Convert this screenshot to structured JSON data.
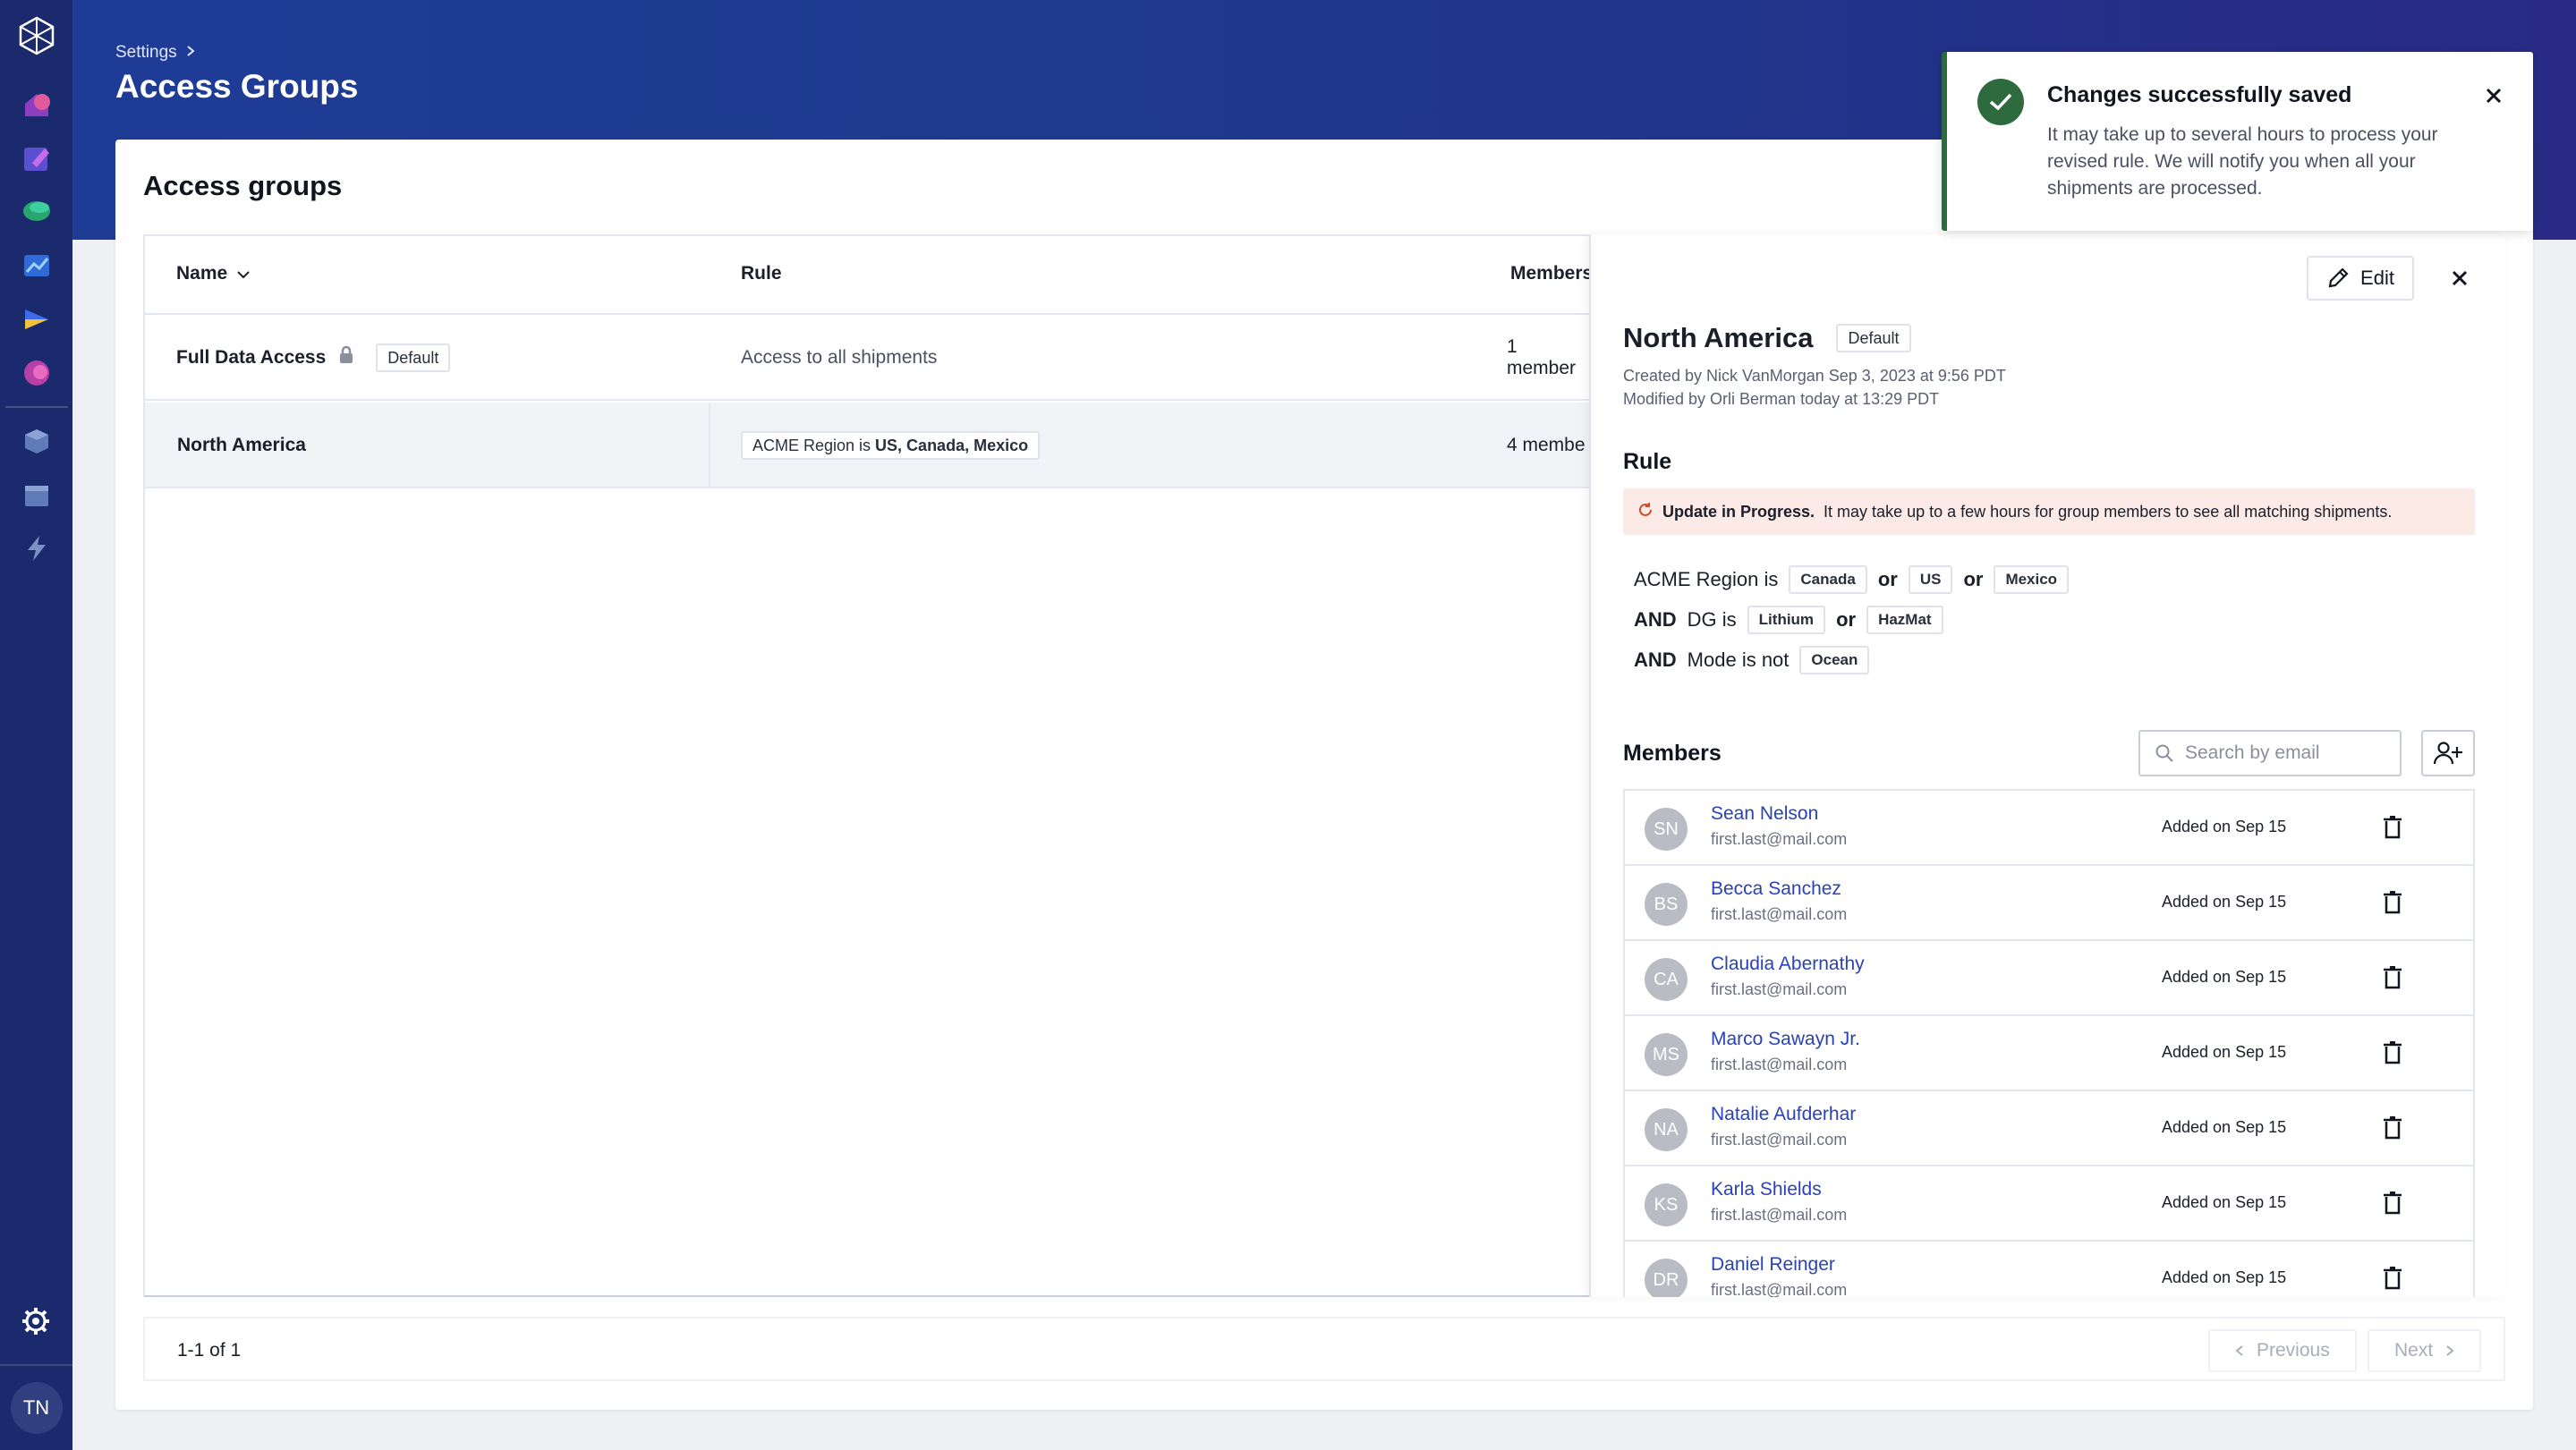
{
  "nav": {
    "user_initials": "TN"
  },
  "header": {
    "breadcrumb": "Settings",
    "title": "Access Groups"
  },
  "main": {
    "card_title": "Access groups",
    "columns": {
      "name": "Name",
      "rule": "Rule",
      "members": "Members"
    },
    "rows": [
      {
        "name": "Full Data Access",
        "badge": "Default",
        "rule": "Access to all shipments",
        "members": "1 member"
      },
      {
        "name": "North America",
        "rule_prefix": "ACME Region is",
        "rule_values": "US, Canada, Mexico",
        "members": "4 membe"
      }
    ],
    "pagination": {
      "range": "1-1 of 1",
      "previous": "Previous",
      "next": "Next"
    }
  },
  "panel": {
    "edit_label": "Edit",
    "title": "North America",
    "badge": "Default",
    "created": "Created by Nick VanMorgan Sep 3, 2023 at 9:56 PDT",
    "modified": "Modified by Orli Berman today at 13:29 PDT",
    "rule_heading": "Rule",
    "alert_bold": "Update in Progress.",
    "alert_text": "It may take up to a few hours for group members to see all matching shipments.",
    "rule": {
      "line1_label": "ACME Region is",
      "line1_values": [
        "Canada",
        "US",
        "Mexico"
      ],
      "line2_op": "AND",
      "line2_label": "DG is",
      "line2_values": [
        "Lithium",
        "HazMat"
      ],
      "line3_op": "AND",
      "line3_label": "Mode is not",
      "line3_values": [
        "Ocean"
      ],
      "or": "or"
    },
    "members_heading": "Members",
    "search_placeholder": "Search by email",
    "members": [
      {
        "initials": "SN",
        "name": "Sean Nelson",
        "email": "first.last@mail.com",
        "added": "Added on Sep 15"
      },
      {
        "initials": "BS",
        "name": "Becca Sanchez",
        "email": "first.last@mail.com",
        "added": "Added on Sep 15"
      },
      {
        "initials": "CA",
        "name": "Claudia Abernathy",
        "email": "first.last@mail.com",
        "added": "Added on Sep 15"
      },
      {
        "initials": "MS",
        "name": "Marco Sawayn Jr.",
        "email": "first.last@mail.com",
        "added": "Added on Sep 15"
      },
      {
        "initials": "NA",
        "name": "Natalie Aufderhar",
        "email": "first.last@mail.com",
        "added": "Added on Sep 15"
      },
      {
        "initials": "KS",
        "name": "Karla Shields",
        "email": "first.last@mail.com",
        "added": "Added on Sep 15"
      },
      {
        "initials": "DR",
        "name": "Daniel Reinger",
        "email": "first.last@mail.com",
        "added": "Added on Sep 15"
      }
    ]
  },
  "toast": {
    "title": "Changes successfully saved",
    "body": "It may take up to several hours to process your revised rule. We will notify you when all your shipments are processed."
  },
  "colors": {
    "sidebar": "#1a2a6c",
    "header": "#1e3c96",
    "link": "#2a43b4",
    "success": "#2d6a3e"
  }
}
